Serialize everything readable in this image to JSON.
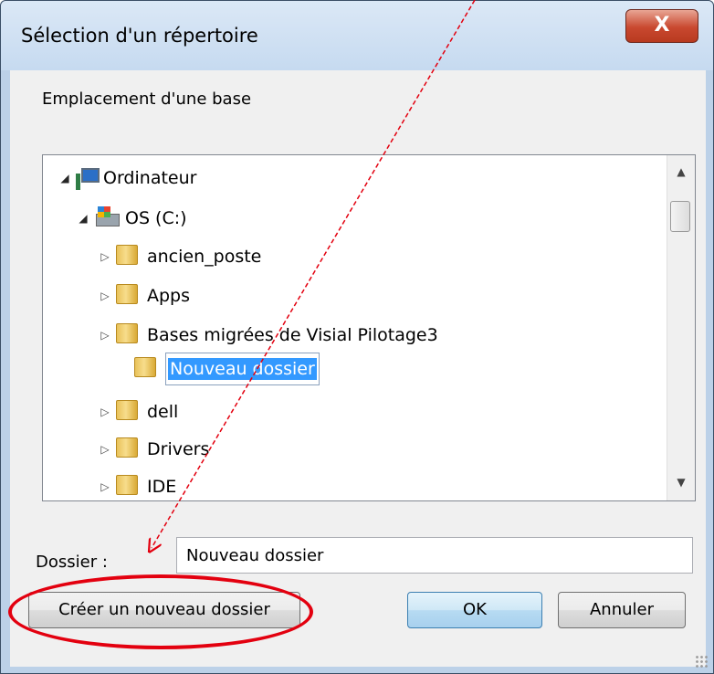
{
  "window": {
    "title": "Sélection d'un répertoire",
    "close_label": "X"
  },
  "prompt": "Emplacement d'une base",
  "tree": {
    "items": [
      {
        "label": "Ordinateur",
        "icon": "computer-icon",
        "expanded": true
      },
      {
        "label": "OS (C:)",
        "icon": "drive-icon",
        "expanded": true
      },
      {
        "label": "ancien_poste",
        "icon": "folder-icon"
      },
      {
        "label": "Apps",
        "icon": "folder-icon"
      },
      {
        "label": "Bases migrées de Visial Pilotage3",
        "icon": "folder-icon"
      },
      {
        "label": "Nouveau dossier",
        "icon": "folder-icon",
        "editing": true
      },
      {
        "label": "dell",
        "icon": "folder-icon"
      },
      {
        "label": "Drivers",
        "icon": "folder-icon"
      },
      {
        "label": "IDE",
        "icon": "folder-icon"
      }
    ]
  },
  "folder_field": {
    "label": "Dossier :",
    "value": "Nouveau dossier"
  },
  "buttons": {
    "new_folder": "Créer un nouveau dossier",
    "ok": "OK",
    "cancel": "Annuler"
  },
  "annotation": {
    "highlight_color": "#e3000f"
  }
}
